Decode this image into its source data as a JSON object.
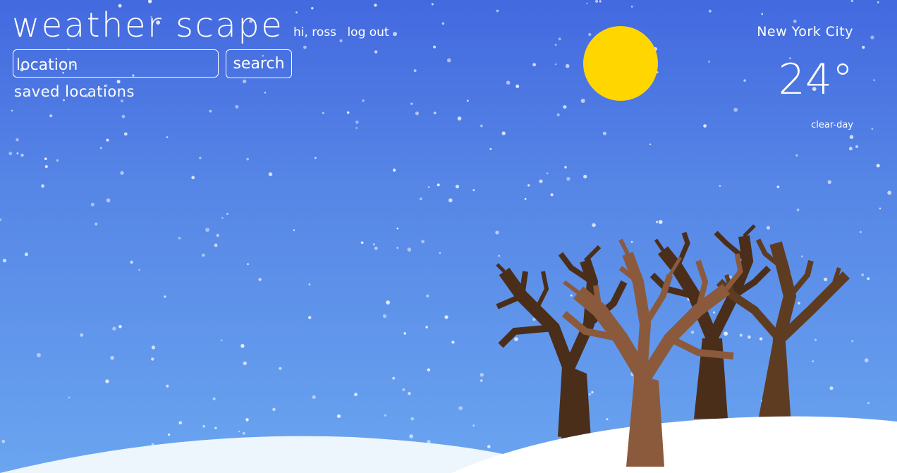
{
  "header": {
    "app_title": "weather scape",
    "greeting": "hi, ross",
    "logout_label": "log out"
  },
  "search": {
    "placeholder": "location",
    "button_label": "search"
  },
  "saved_locations_label": "saved locations",
  "weather": {
    "city": "New York City",
    "temperature": "24°",
    "condition": "clear-day"
  },
  "colors": {
    "sky_top": "#4369df",
    "sky_bottom": "#6aa5f0",
    "sun": "#ffd600",
    "snow_ground": "#ffffff",
    "tree_dark": "#4a2e1a",
    "tree_light": "#8b5a3c"
  }
}
